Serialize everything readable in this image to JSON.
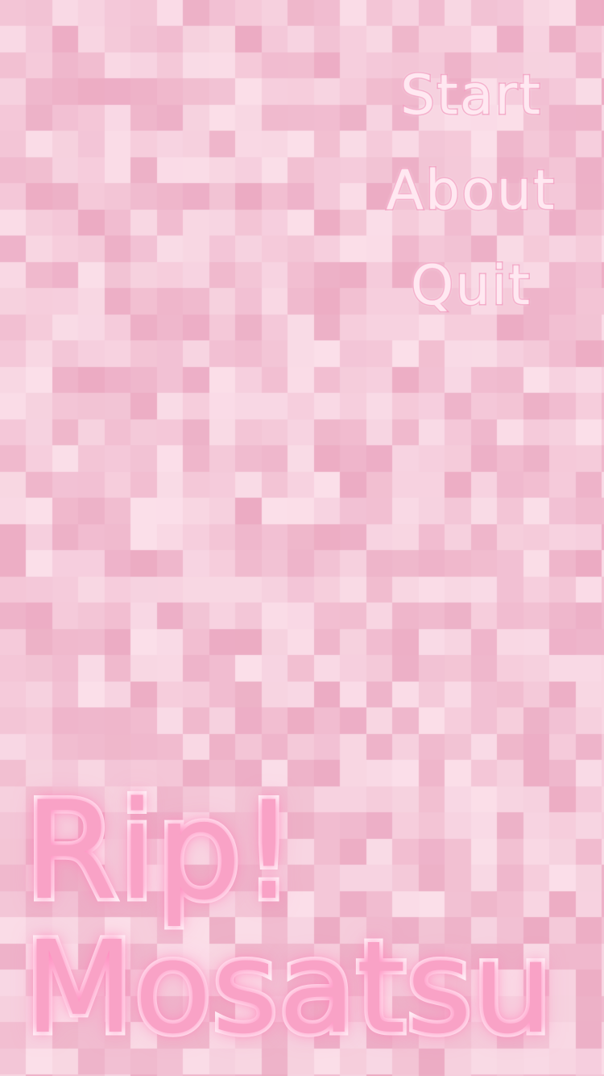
{
  "menu": {
    "items": [
      {
        "label": "Start"
      },
      {
        "label": "About"
      },
      {
        "label": "Quit"
      }
    ]
  },
  "title": {
    "line1": "Rip!",
    "line2": "Mosatsu"
  },
  "colors": {
    "background": "#f2c2d3",
    "mosaic_light": "#fbe1ea",
    "mosaic_dark": "#e79ab6",
    "title_fill": "#f9a2c6",
    "title_outline": "#ffffff",
    "menu_fill": "#ffe8f1",
    "menu_outline": "#f29ec0"
  }
}
